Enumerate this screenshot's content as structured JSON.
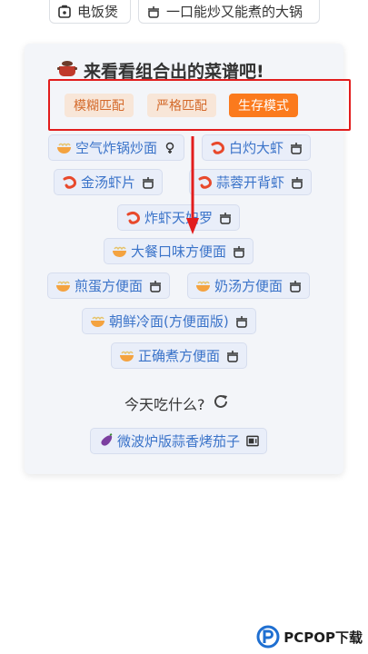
{
  "top_bar": {
    "items": [
      {
        "label": "电饭煲",
        "icon": "rice-cooker-icon"
      },
      {
        "label": "一口能炒又能煮的大锅",
        "icon": "pot-icon"
      }
    ]
  },
  "card": {
    "title": "来看看组合出的菜谱吧!",
    "title_icon": "pot-icon",
    "modes": [
      "模糊匹配",
      "严格匹配",
      "生存模式"
    ],
    "active_mode": "生存模式",
    "recipes": [
      {
        "name": "空气炸锅炒面",
        "emoji": "noodle-bowl-icon",
        "tool": "air-fryer-icon"
      },
      {
        "name": "白灼大虾",
        "emoji": "shrimp-icon",
        "tool": "pot-icon"
      },
      {
        "name": "金汤虾片",
        "emoji": "shrimp-icon",
        "tool": "pot-icon"
      },
      {
        "name": "蒜蓉开背虾",
        "emoji": "shrimp-icon",
        "tool": "pot-icon"
      },
      {
        "name": "炸虾天妇罗",
        "emoji": "shrimp-icon",
        "tool": "pot-icon"
      },
      {
        "name": "大餐口味方便面",
        "emoji": "noodle-bowl-icon",
        "tool": "pot-icon"
      },
      {
        "name": "煎蛋方便面",
        "emoji": "noodle-bowl-icon",
        "tool": "pot-icon"
      },
      {
        "name": "奶汤方便面",
        "emoji": "noodle-bowl-icon",
        "tool": "pot-icon"
      },
      {
        "name": "朝鲜冷面(方便面版)",
        "emoji": "noodle-bowl-icon",
        "tool": "pot-icon"
      },
      {
        "name": "正确煮方便面",
        "emoji": "noodle-bowl-icon",
        "tool": "pot-icon"
      }
    ],
    "today_label": "今天吃什么?",
    "today_pick": {
      "name": "微波炉版蒜香烤茄子",
      "emoji": "eggplant-icon",
      "tool": "microwave-icon"
    }
  },
  "watermark": {
    "text": "PCPOP下载"
  },
  "colors": {
    "accent_orange": "#fb7a1d",
    "mode_bg": "#f8e6d8",
    "recipe_text": "#3a73c9",
    "highlight_red": "#e21d1d"
  }
}
